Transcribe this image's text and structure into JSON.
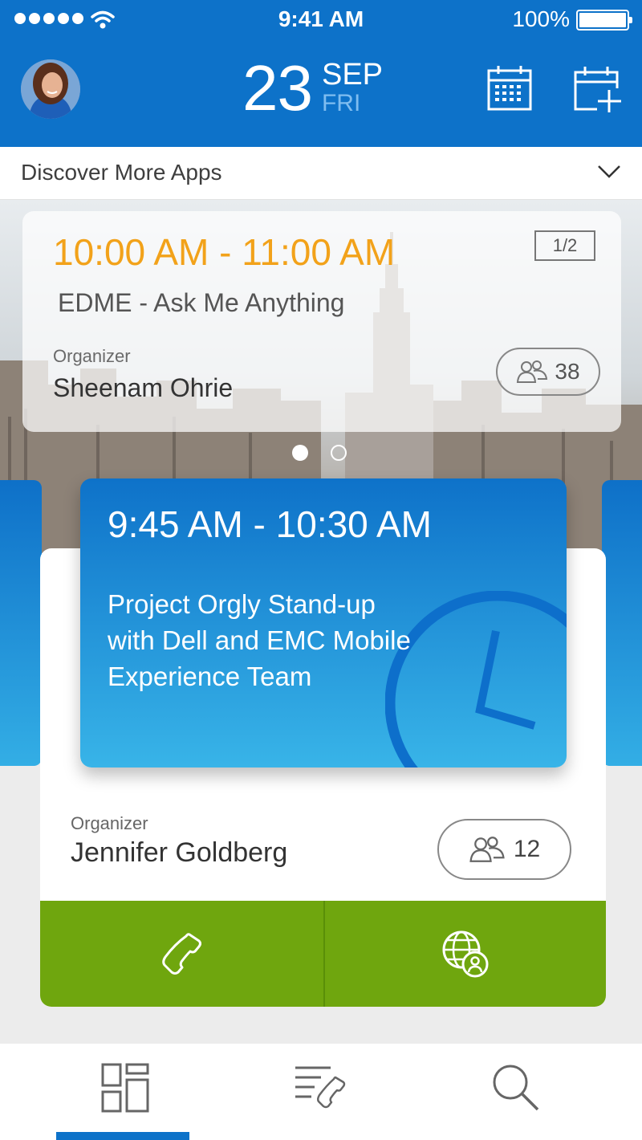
{
  "status_bar": {
    "time": "9:41 AM",
    "battery": "100%"
  },
  "header": {
    "day": "23",
    "month": "SEP",
    "weekday": "FRI",
    "brand_color": "#0d72c9"
  },
  "discover": {
    "label": "Discover More Apps"
  },
  "meeting_card_top": {
    "time": "10:00 AM - 11:00 AM",
    "page": "1/2",
    "title": "EDME - Ask Me Anything",
    "organizer_label": "Organizer",
    "organizer_name": "Sheenam Ohrie",
    "attendees": "38"
  },
  "meeting_card_main": {
    "time": "9:45 AM - 10:30 AM",
    "title": "Project Orgly Stand-up with Dell and EMC Mobile Experience Team",
    "organizer_label": "Organizer",
    "organizer_name": "Jennifer Goldberg",
    "attendees": "12",
    "actions": [
      "phone-icon",
      "globe-user-icon"
    ],
    "action_color": "#6fa60e"
  },
  "tabs": [
    {
      "icon": "dashboard-grid-icon",
      "active": true
    },
    {
      "icon": "call-log-icon",
      "active": false
    },
    {
      "icon": "search-icon",
      "active": false
    }
  ]
}
